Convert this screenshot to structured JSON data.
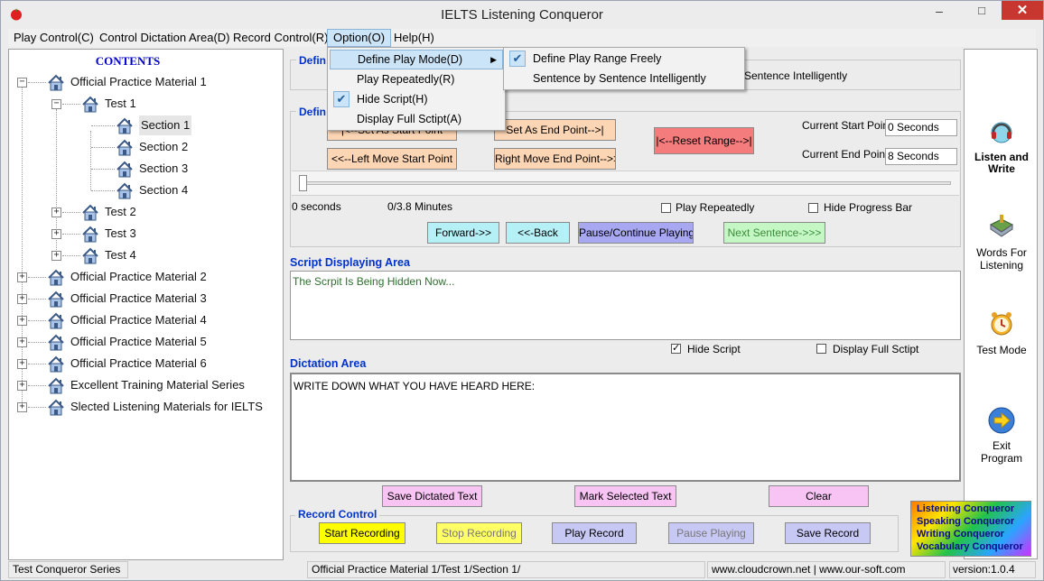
{
  "window": {
    "title": "IELTS Listening Conqueror",
    "minimize": "–",
    "maximize": "□",
    "close": "✕"
  },
  "menu": [
    "Play Control(C)",
    "Control Dictation Area(D)",
    "Record Control(R)",
    "Option(O)",
    "Help(H)"
  ],
  "tree": {
    "title": "CONTENTS",
    "nodes": [
      {
        "label": "Official Practice Material 1",
        "level": 0,
        "expander": "−"
      },
      {
        "label": "Test 1",
        "level": 1,
        "expander": "−"
      },
      {
        "label": "Section 1",
        "level": 2,
        "selected": true
      },
      {
        "label": "Section 2",
        "level": 2
      },
      {
        "label": "Section 3",
        "level": 2
      },
      {
        "label": "Section 4",
        "level": 2
      },
      {
        "label": "Test 2",
        "level": 1,
        "expander": "+"
      },
      {
        "label": "Test 3",
        "level": 1,
        "expander": "+"
      },
      {
        "label": "Test 4",
        "level": 1,
        "expander": "+"
      },
      {
        "label": "Official Practice Material 2",
        "level": 0,
        "expander": "+"
      },
      {
        "label": "Official Practice Material 3",
        "level": 0,
        "expander": "+"
      },
      {
        "label": "Official Practice Material 4",
        "level": 0,
        "expander": "+"
      },
      {
        "label": "Official Practice Material 5",
        "level": 0,
        "expander": "+"
      },
      {
        "label": "Official Practice Material 6",
        "level": 0,
        "expander": "+"
      },
      {
        "label": "Excellent Training Material Series",
        "level": 0,
        "expander": "+"
      },
      {
        "label": "Slected Listening Materials for IELTS",
        "level": 0,
        "expander": "+"
      }
    ]
  },
  "mode_group": {
    "label": "Defin",
    "visible_text": "Sentence Intelligently"
  },
  "range_group": {
    "label": "Defin",
    "set_start": "|<--Set As Start Point",
    "set_end": "Set As End Point-->|",
    "reset": "|<--Reset Range-->|",
    "move_start": "<<--Left Move Start Point",
    "move_end": "Right Move End Point-->>",
    "current_start_label": "Current Start Point:",
    "current_start_value": "0 Seconds",
    "current_end_label": "Current  End Point:",
    "current_end_value": "8 Seconds",
    "time_elapsed": "0 seconds",
    "time_total": "0/3.8 Minutes",
    "play_repeatedly": "Play Repeatedly",
    "hide_progress": "Hide Progress Bar",
    "progress_fraction": 0.0
  },
  "transport": {
    "forward": "Forward->>",
    "back": "<<-Back",
    "pause": "Pause/Continue Playing-||",
    "next": "Next Sentence->>>"
  },
  "script": {
    "title": "Script Displaying Area",
    "text": "The Scrpit Is Being Hidden Now...",
    "hide_label": "Hide Script",
    "hide_checked": true,
    "full_label": "Display Full Sctipt",
    "full_checked": false
  },
  "dictation": {
    "title": "Dictation Area",
    "text": "WRITE DOWN WHAT YOU HAVE HEARD HERE:",
    "save": "Save Dictated Text",
    "mark": "Mark Selected Text",
    "clear": "Clear"
  },
  "record": {
    "title": "Record Control",
    "start": "Start Recording",
    "stop": "Stop Recording",
    "play": "Play Record",
    "pause": "Pause Playing",
    "save": "Save Record"
  },
  "side": [
    {
      "label1": "Listen and",
      "label2": "Write",
      "icon": "headset-icon"
    },
    {
      "label1": "Words For",
      "label2": "Listening",
      "icon": "book-icon"
    },
    {
      "label1": "Test Mode",
      "label2": "",
      "icon": "alarm-clock-icon"
    },
    {
      "label1": "Exit",
      "label2": "Program",
      "icon": "arrow-right-icon"
    }
  ],
  "logo": [
    "Listening Conqueror",
    "Speaking Conqueror",
    "Writing Conqueror",
    "Vocabulary Conqueror"
  ],
  "status": {
    "left": "Test Conqueror Series",
    "middle": "Official Practice Material 1/Test 1/Section 1/",
    "url": "www.cloudcrown.net | www.our-soft.com",
    "version": "version:1.0.4"
  },
  "option_menu": {
    "items": [
      {
        "label": "Define Play Mode(D)",
        "arrow": "▶",
        "highlighted": true
      },
      {
        "label": "Play Repeatedly(R)"
      },
      {
        "label": "Hide Script(H)",
        "checked": true
      },
      {
        "label": "Display Full Sctipt(A)"
      }
    ],
    "submenu": [
      {
        "label": "Define Play Range Freely",
        "checked": true
      },
      {
        "label": "Sentence by Sentence Intelligently"
      }
    ]
  },
  "colors": {
    "accent_blue": "#0033cc",
    "close_red": "#c7372f",
    "highlight": "#cce4f7"
  }
}
